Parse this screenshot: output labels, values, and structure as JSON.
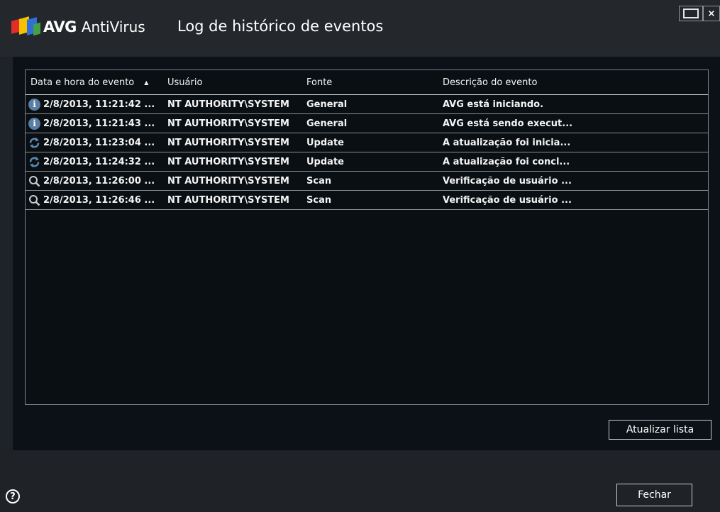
{
  "app": {
    "brand": "AVG",
    "product": "AntiVirus",
    "window_title": "Log de histórico de eventos",
    "maximize_icon": "maximize-icon",
    "close_icon": "close-icon",
    "close_glyph": "×"
  },
  "table": {
    "columns": [
      "Data e hora do evento",
      "Usuário",
      "Fonte",
      "Descrição do evento"
    ],
    "sort_indicator": "▲",
    "rows": [
      {
        "icon": "info-icon",
        "date": "2/8/2013, 11:21:42 ...",
        "user": "NT AUTHORITY\\SYSTEM",
        "source": "General",
        "description": "AVG está iniciando."
      },
      {
        "icon": "info-icon",
        "date": "2/8/2013, 11:21:43 ...",
        "user": "NT AUTHORITY\\SYSTEM",
        "source": "General",
        "description": "AVG está sendo execut..."
      },
      {
        "icon": "update-icon",
        "date": "2/8/2013, 11:23:04 ...",
        "user": "NT AUTHORITY\\SYSTEM",
        "source": "Update",
        "description": "A atualização foi inicia..."
      },
      {
        "icon": "update-icon",
        "date": "2/8/2013, 11:24:32 ...",
        "user": "NT AUTHORITY\\SYSTEM",
        "source": "Update",
        "description": "A atualização foi concl..."
      },
      {
        "icon": "scan-icon",
        "date": "2/8/2013, 11:26:00 ...",
        "user": "NT AUTHORITY\\SYSTEM",
        "source": "Scan",
        "description": "Verificação de usuário ..."
      },
      {
        "icon": "scan-icon",
        "date": "2/8/2013, 11:26:46 ...",
        "user": "NT AUTHORITY\\SYSTEM",
        "source": "Scan",
        "description": "Verificação de usuário ..."
      }
    ]
  },
  "buttons": {
    "refresh": "Atualizar lista",
    "close": "Fechar",
    "help_glyph": "?"
  },
  "colors": {
    "background": "#1f2226",
    "panel": "#0b1116",
    "info_icon": "#5a7ea3",
    "logo_red": "#e52d27",
    "logo_yellow": "#f5c200",
    "logo_blue": "#2e6fd8",
    "logo_green": "#43a047"
  }
}
